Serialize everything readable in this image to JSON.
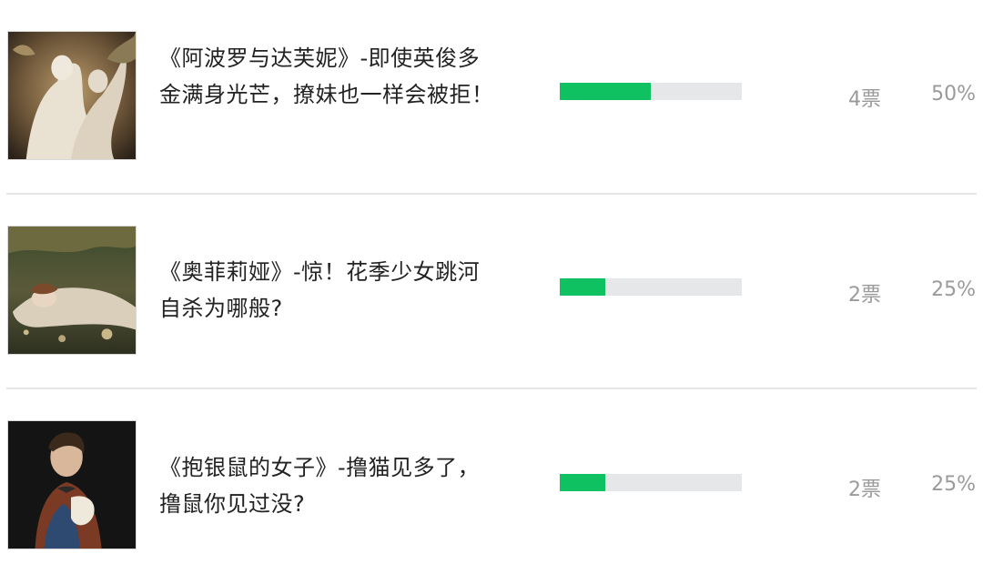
{
  "options": [
    {
      "title": "《阿波罗与达芙妮》-即使英俊多金满身光芒，撩妹也一样会被拒！",
      "votes": "4票",
      "percent": "50%",
      "share": 0.5,
      "thumbnail": "apollo-and-daphne-sculpture-image"
    },
    {
      "title": "《奥菲莉娅》-惊！花季少女跳河自杀为哪般?",
      "votes": "2票",
      "percent": "25%",
      "share": 0.25,
      "thumbnail": "ophelia-painting-image"
    },
    {
      "title": "《抱银鼠的女子》-撸猫见多了，撸鼠你见过没?",
      "votes": "2票",
      "percent": "25%",
      "share": 0.25,
      "thumbnail": "lady-with-an-ermine-painting-image"
    }
  ],
  "colors": {
    "bar_fill": "#0fc160",
    "bar_track": "#e6e7e9",
    "meta_text": "#9a9a9a",
    "divider": "#e6e6e6"
  }
}
